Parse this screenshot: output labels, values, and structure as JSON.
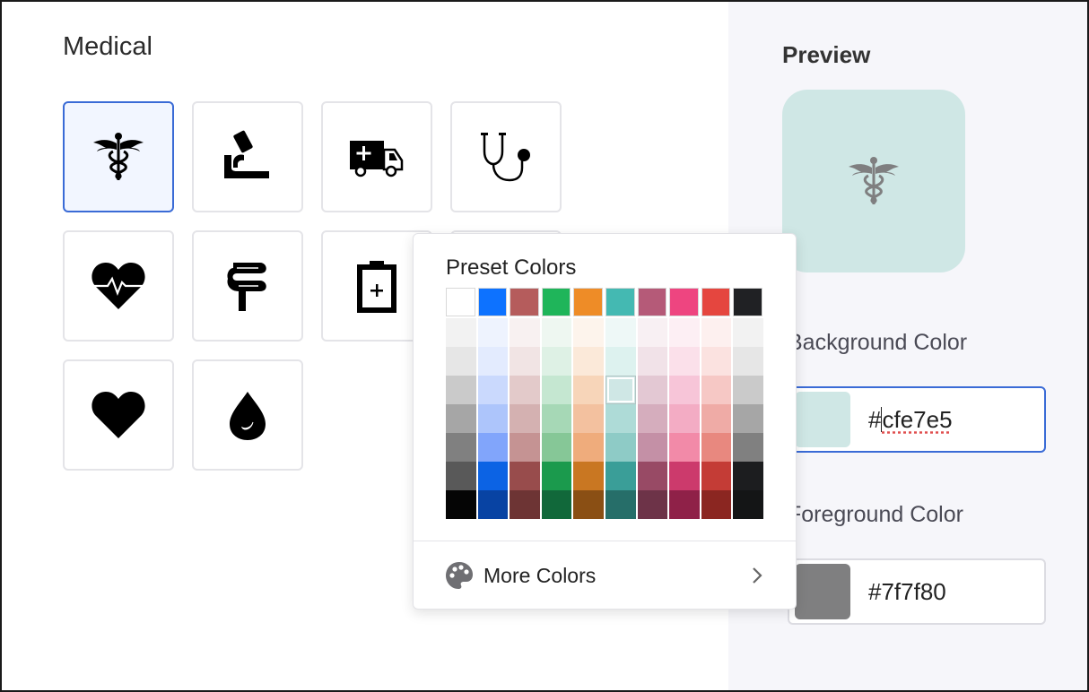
{
  "section": {
    "title": "Medical"
  },
  "icons": [
    {
      "name": "caduceus-icon",
      "selected": true
    },
    {
      "name": "microscope-icon",
      "selected": false
    },
    {
      "name": "ambulance-icon",
      "selected": false
    },
    {
      "name": "stethoscope-icon",
      "selected": false
    },
    {
      "name": "heartbeat-icon",
      "selected": false
    },
    {
      "name": "intestines-icon",
      "selected": false
    },
    {
      "name": "clipboard-medical-icon",
      "selected": false
    },
    {
      "name": "hidden-icon",
      "selected": false
    },
    {
      "name": "heart-icon",
      "selected": false
    },
    {
      "name": "blood-drop-icon",
      "selected": false
    }
  ],
  "popover": {
    "title": "Preset Colors",
    "presets": [
      "#ffffff",
      "#0d72ff",
      "#b55c5c",
      "#1fb55a",
      "#ee8c27",
      "#44b9b2",
      "#b55a78",
      "#ee4580",
      "#e5463f",
      "#202124"
    ],
    "shades": [
      [
        "#f2f2f2",
        "#eef3fe",
        "#f8f1f1",
        "#eef7f1",
        "#fdf4ec",
        "#eef8f7",
        "#f8f0f3",
        "#fdeff4",
        "#fdf0ef",
        "#f2f2f2"
      ],
      [
        "#e6e6e6",
        "#e3ebfe",
        "#f1e4e4",
        "#def1e5",
        "#fbe9d9",
        "#ddf2ef",
        "#f1e2e8",
        "#fbe0ea",
        "#fbe2e0",
        "#e6e6e6"
      ],
      [
        "#cacaca",
        "#cad9fd",
        "#e3caca",
        "#c5e7d1",
        "#f7d5b9",
        "#cfe7e5",
        "#e3c8d3",
        "#f7c5d8",
        "#f6c8c5",
        "#cacaca"
      ],
      [
        "#a6a6a6",
        "#adc5fb",
        "#d4b1b1",
        "#a6d8b6",
        "#f3c19f",
        "#aedbd7",
        "#d5adbd",
        "#f3acc4",
        "#efaba6",
        "#a6a6a6"
      ],
      [
        "#808080",
        "#81a5fb",
        "#c59393",
        "#86c797",
        "#efac7c",
        "#8ecbc6",
        "#c490a6",
        "#f28aa8",
        "#e8887f",
        "#808080"
      ],
      [
        "#595959",
        "#0c63e4",
        "#984c4c",
        "#1b9a4d",
        "#c97722",
        "#3a9e98",
        "#984a65",
        "#cc3a6c",
        "#c43c36",
        "#1c1d1f"
      ],
      [
        "#050505",
        "#0843a3",
        "#6d3434",
        "#11683a",
        "#8a4f14",
        "#266e69",
        "#6d3348",
        "#8f2148",
        "#8b2621",
        "#141516"
      ]
    ],
    "selected_shade": {
      "row": 2,
      "col": 5
    },
    "more_colors_label": "More Colors"
  },
  "preview": {
    "label": "Preview",
    "bg_color": "#cfe7e5",
    "fg_color": "#7f7f80"
  },
  "background": {
    "label": "Background Color",
    "hash": "#",
    "value": "cfe7e5",
    "swatch": "#cfe7e5"
  },
  "foreground": {
    "label": "Foreground Color",
    "value": "#7f7f80",
    "swatch": "#7f7f80"
  }
}
